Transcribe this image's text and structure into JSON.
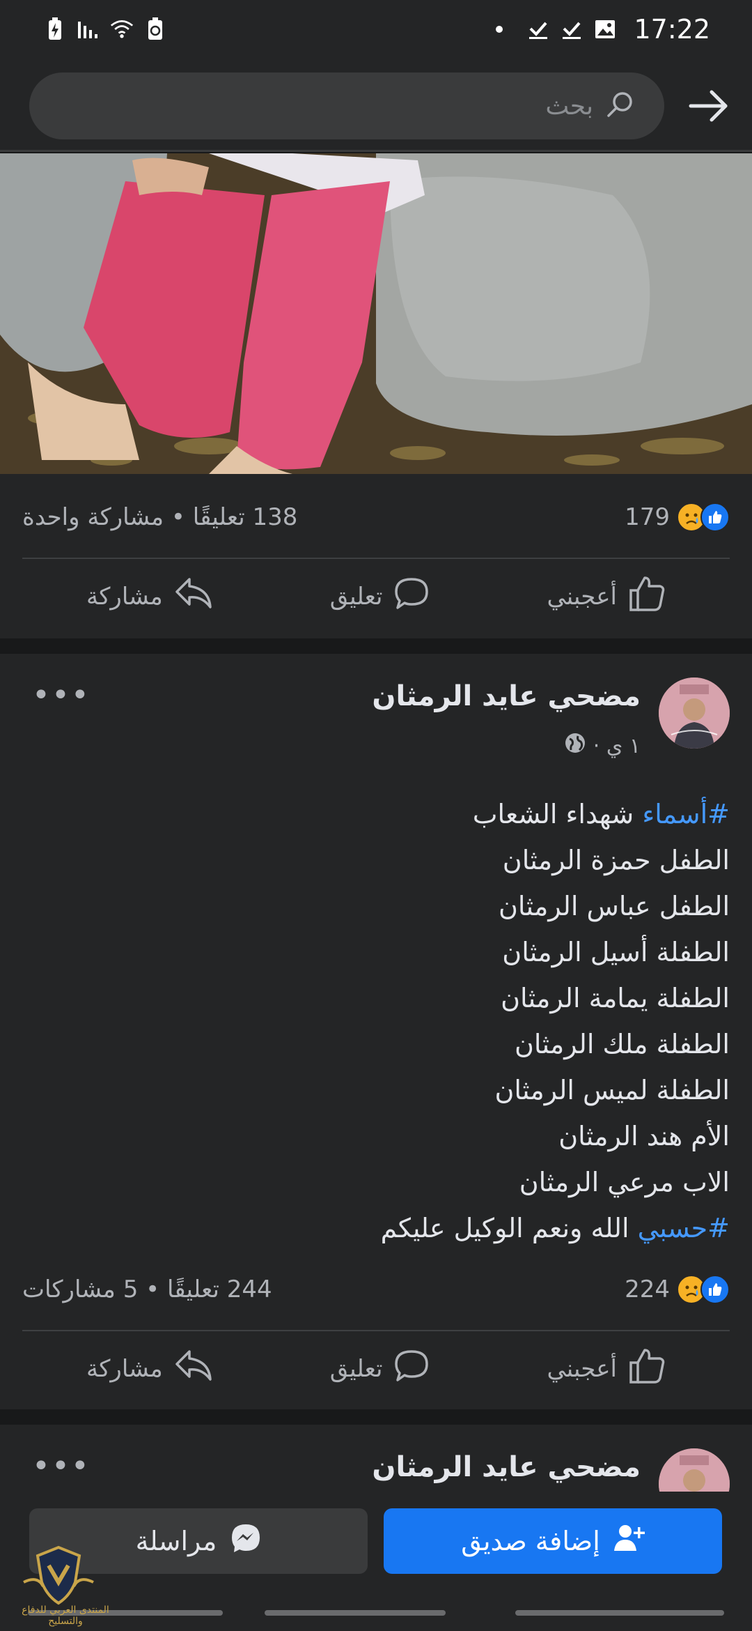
{
  "status_bar": {
    "time": "17:22"
  },
  "search": {
    "placeholder": "بحث"
  },
  "post1": {
    "reaction_count": "179",
    "comments_shares": "138 تعليقًا • مشاركة واحدة"
  },
  "actions": {
    "like": "أعجبني",
    "comment": "تعليق",
    "share": "مشاركة"
  },
  "post2": {
    "author": "مضحي عايد الرمثان",
    "time": "١ ي ·",
    "lines": [
      {
        "hashtag": "#أسماء",
        "text": " شهداء الشعاب"
      },
      {
        "text": "الطفل حمزة الرمثان"
      },
      {
        "text": "الطفل عباس الرمثان"
      },
      {
        "text": "الطفلة أسيل الرمثان"
      },
      {
        "text": "الطفلة يمامة الرمثان"
      },
      {
        "text": "الطفلة ملك الرمثان"
      },
      {
        "text": "الطفلة لميس الرمثان"
      },
      {
        "text": "الأم هند الرمثان"
      },
      {
        "text": "الاب مرعي الرمثان"
      },
      {
        "hashtag": "#حسبي",
        "text": " الله ونعم الوكيل عليكم"
      }
    ],
    "reaction_count": "224",
    "comments_shares": "244 تعليقًا • 5 مشاركات"
  },
  "post3": {
    "author": "مضحي عايد الرمثان"
  },
  "bottom": {
    "add_friend": "إضافة صديق",
    "message": "مراسلة"
  },
  "watermark": {
    "text": "المنتدى العربي للدفاع والتسليح"
  }
}
